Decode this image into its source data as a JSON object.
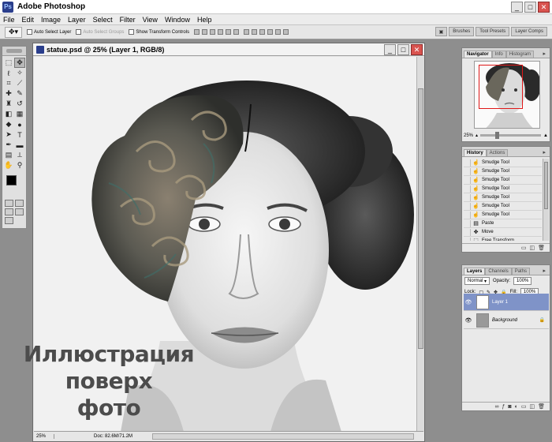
{
  "window": {
    "title": "Adobe Photoshop",
    "logo_text": "Ps",
    "min": "_",
    "max": "□",
    "close": "✕"
  },
  "menu": [
    "File",
    "Edit",
    "Image",
    "Layer",
    "Select",
    "Filter",
    "View",
    "Window",
    "Help"
  ],
  "options_bar": {
    "tool_icon": "move-tool",
    "auto_select_layer": "Auto Select Layer",
    "auto_select_groups": "Auto Select Groups",
    "show_transform_controls": "Show Transform Controls",
    "palette_tabs": [
      "Brushes",
      "Tool Presets",
      "Layer Comps"
    ]
  },
  "document": {
    "title": "statue.psd @ 25% (Layer 1, RGB/8)",
    "zoom": "25%",
    "doc_size": "Doc: 82.6M/71.2M"
  },
  "caption": {
    "line1": "Иллюстрация",
    "line2": "поверх",
    "line3": "фото"
  },
  "navigator": {
    "tabs": [
      "Navigator",
      "Info",
      "Histogram"
    ],
    "zoom": "25%",
    "zoom_fraction": 0.25
  },
  "history": {
    "tabs": [
      "History",
      "Actions"
    ],
    "items": [
      {
        "label": "Smudge Tool",
        "icon": "smudge-icon"
      },
      {
        "label": "Smudge Tool",
        "icon": "smudge-icon"
      },
      {
        "label": "Smudge Tool",
        "icon": "smudge-icon"
      },
      {
        "label": "Smudge Tool",
        "icon": "smudge-icon"
      },
      {
        "label": "Smudge Tool",
        "icon": "smudge-icon"
      },
      {
        "label": "Smudge Tool",
        "icon": "smudge-icon"
      },
      {
        "label": "Smudge Tool",
        "icon": "smudge-icon"
      },
      {
        "label": "Paste",
        "icon": "paste-icon"
      },
      {
        "label": "Move",
        "icon": "move-icon"
      },
      {
        "label": "Free Transform",
        "icon": "transform-icon"
      },
      {
        "label": "Move",
        "icon": "move-icon",
        "current": true
      }
    ]
  },
  "layers": {
    "tabs": [
      "Layers",
      "Channels",
      "Paths"
    ],
    "blend_mode": "Normal",
    "opacity_label": "Opacity:",
    "opacity": "100%",
    "lock_label": "Lock:",
    "fill_label": "Fill:",
    "fill": "100%",
    "items": [
      {
        "name": "Layer 1",
        "active": true
      },
      {
        "name": "Background",
        "locked": true
      }
    ]
  },
  "colors": {
    "foreground": "#000000",
    "background": "#ffffff",
    "selection": "#7f93c8",
    "nav_view": "#e01818"
  }
}
